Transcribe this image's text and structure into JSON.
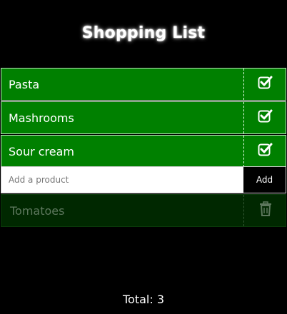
{
  "app": {
    "title": "Shopping List"
  },
  "items": [
    {
      "label": "Pasta",
      "icon": "checkbox-checked-icon"
    },
    {
      "label": "Mashrooms",
      "icon": "checkbox-checked-icon"
    },
    {
      "label": "Sour cream",
      "icon": "checkbox-checked-icon"
    }
  ],
  "add_form": {
    "placeholder": "Add a product",
    "button_label": "Add"
  },
  "done_items": [
    {
      "label": "Tomatoes",
      "icon": "trash-icon"
    }
  ],
  "footer": {
    "total_label": "Total: 3"
  },
  "colors": {
    "background": "#000000",
    "item_bg": "#008000",
    "done_item_bg": "#002800",
    "done_text": "#5d775d",
    "text": "#ffffff"
  }
}
